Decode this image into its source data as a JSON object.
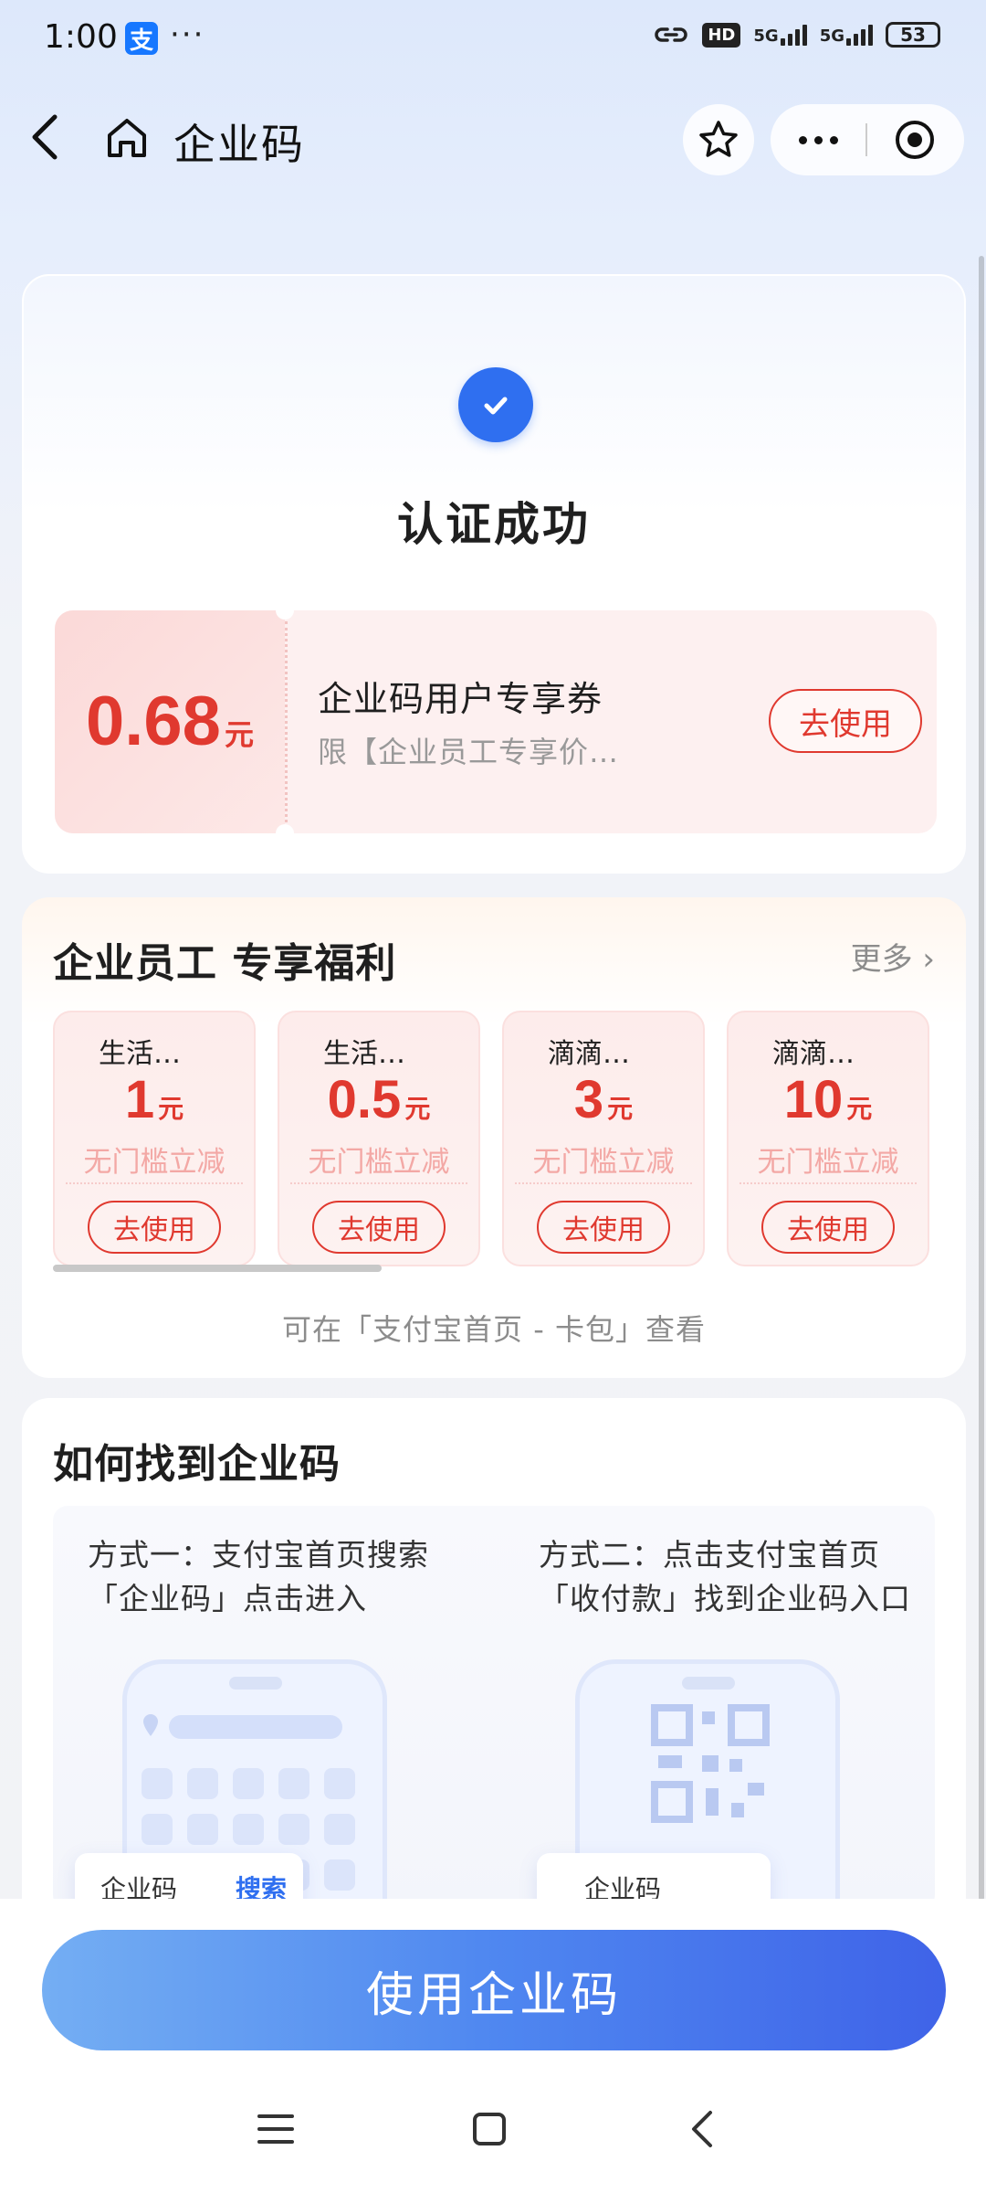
{
  "status_bar": {
    "time": "1:00",
    "app_icon_char": "支",
    "more": "···",
    "hd": "HD",
    "net1": "5G",
    "net2": "5G",
    "battery": "53"
  },
  "nav": {
    "title": "企业码"
  },
  "success": {
    "title": "认证成功",
    "accent_color": "#2f6ff0"
  },
  "coupon": {
    "amount": "0.68",
    "unit": "元",
    "name": "企业码用户专享券",
    "desc": "限【企业员工专享价…",
    "button": "去使用",
    "color": "#e0392f"
  },
  "benefits": {
    "title": "企业员工 专享福利",
    "more": "更多 ›",
    "items": [
      {
        "name": "生活…",
        "value": "1",
        "unit": "元",
        "sub": "无门槛立减",
        "button": "去使用"
      },
      {
        "name": "生活…",
        "value": "0.5",
        "unit": "元",
        "sub": "无门槛立减",
        "button": "去使用"
      },
      {
        "name": "滴滴…",
        "value": "3",
        "unit": "元",
        "sub": "无门槛立减",
        "button": "去使用"
      },
      {
        "name": "滴滴…",
        "value": "10",
        "unit": "元",
        "sub": "无门槛立减",
        "button": "去使用"
      }
    ],
    "hint": "可在「支付宝首页 - 卡包」查看"
  },
  "howto": {
    "title": "如何找到企业码",
    "method1_line1": "方式一：支付宝首页搜索",
    "method1_line2": "「企业码」点击进入",
    "method2_line1": "方式二：点击支付宝首页",
    "method2_line2": "「收付款」找到企业码入口",
    "search_bar_label": "企业码",
    "search_bar_button": "搜索",
    "pay_bar_label": "企业码"
  },
  "cta": {
    "label": "使用企业码"
  }
}
